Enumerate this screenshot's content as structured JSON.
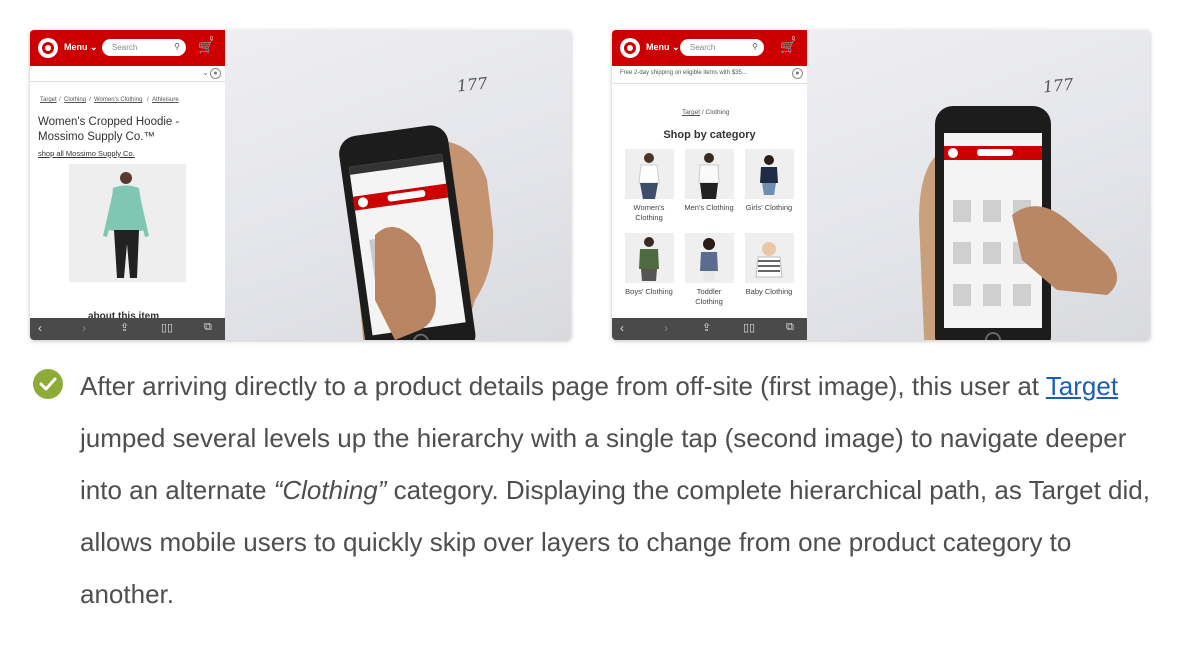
{
  "left_screen": {
    "menu_label": "Menu",
    "search_placeholder": "Search",
    "cart_count": "0",
    "breadcrumb": [
      "Target",
      "Clothing",
      "Women's Clothing",
      "Athleisure"
    ],
    "product_title": "Women's Cropped Hoodie - Mossimo Supply Co.™",
    "shop_all_link": "shop all Mossimo Supply Co.",
    "about_label": "about this item",
    "photo_note": "177"
  },
  "right_screen": {
    "menu_label": "Menu",
    "search_placeholder": "Search",
    "cart_count": "0",
    "free_shipping": "Free 2-day shipping on eligible items with $35...",
    "breadcrumb_link": "Target",
    "breadcrumb_current": "Clothing",
    "heading": "Shop by category",
    "categories": [
      "Women's Clothing",
      "Men's Clothing",
      "Girls' Clothing",
      "Boys' Clothing",
      "Toddler Clothing",
      "Baby Clothing"
    ],
    "photo_note": "177"
  },
  "caption": {
    "part1": "After arriving directly to a product details page from off-site (first image), this user at ",
    "link_text": "Target",
    "part2": " jumped several levels up the hierarchy with a single tap (second image) to navigate deeper into an alternate ",
    "emphasis": "“Clothing”",
    "part3": " category. Displaying the complete hierarchical path, as Target did, allows mobile users to quickly skip over layers to change from one product category to another."
  },
  "colors": {
    "target_red": "#cc0000",
    "check_green": "#8dac37",
    "link_blue": "#1a5fb4"
  }
}
